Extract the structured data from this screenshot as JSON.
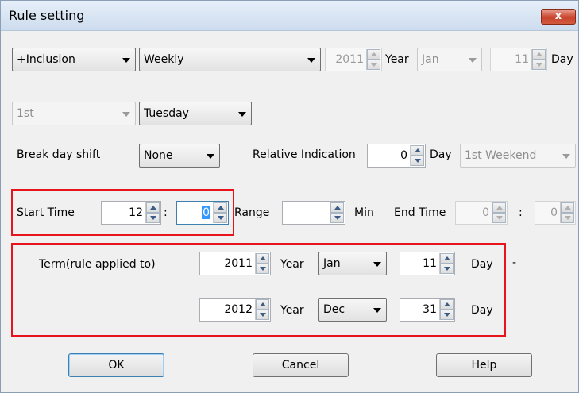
{
  "window": {
    "title": "Rule setting",
    "close_glyph": "x"
  },
  "row1": {
    "rule_type": "+Inclusion",
    "period": "Weekly",
    "year_value": "2011",
    "year_label": "Year",
    "month_value": "Jan",
    "day_value": "11",
    "day_label": "Day"
  },
  "row2": {
    "ordinal": "1st",
    "weekday": "Tuesday"
  },
  "row3": {
    "break_label": "Break day shift",
    "break_value": "None",
    "relative_label": "Relative Indication",
    "relative_value": "0",
    "day_label": "Day",
    "weekend_value": "1st Weekend"
  },
  "row4": {
    "start_label": "Start Time",
    "start_hour": "12",
    "colon": ":",
    "start_minute": "0",
    "range_label": "Range",
    "range_value": "",
    "min_label": "Min",
    "end_label": "End Time",
    "end_hour": "0",
    "end_minute": "0"
  },
  "term": {
    "label": "Term(rule applied to)",
    "from_year": "2011",
    "year_label": "Year",
    "from_month": "Jan",
    "from_day": "11",
    "day_label": "Day",
    "dash": "-",
    "to_year": "2012",
    "to_month": "Dec",
    "to_day": "31"
  },
  "buttons": {
    "ok": "OK",
    "cancel": "Cancel",
    "help": "Help"
  },
  "colors": {
    "highlight_border": "#e8141c",
    "dialog_bg": "#f0f0f0",
    "close_button": "#c9442c"
  }
}
